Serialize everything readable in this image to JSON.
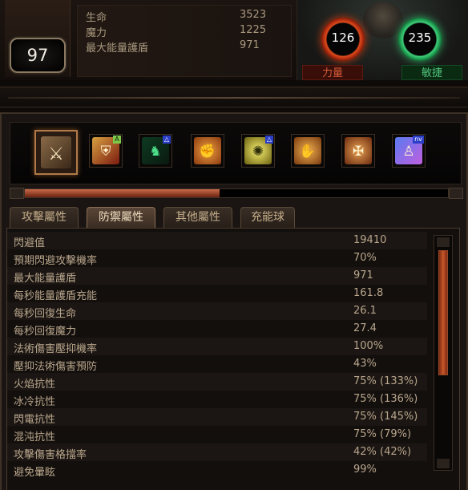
{
  "header": {
    "level": "97",
    "stats": [
      {
        "label": "生命",
        "value": "3523"
      },
      {
        "label": "魔力",
        "value": "1225"
      },
      {
        "label": "最大能量護盾",
        "value": "971"
      }
    ],
    "strength": {
      "value": "126",
      "label": "力量"
    },
    "dexterity": {
      "value": "235",
      "label": "敏捷"
    }
  },
  "skill_bar": {
    "gems": [
      {
        "icon": "sword-icon",
        "badge": ""
      },
      {
        "icon": "shield-icon",
        "badge": "A"
      },
      {
        "icon": "ghost-warrior-icon",
        "badge": "△"
      },
      {
        "icon": "fist-strike-icon",
        "badge": ""
      },
      {
        "icon": "lightning-burst-icon",
        "badge": "△"
      },
      {
        "icon": "grasp-icon",
        "badge": ""
      },
      {
        "icon": "crossed-blade-icon",
        "badge": ""
      },
      {
        "icon": "spectral-figure-icon",
        "badge": "nv"
      }
    ],
    "progress": 0.46
  },
  "tabs": [
    {
      "label": "攻擊屬性",
      "active": false
    },
    {
      "label": "防禦屬性",
      "active": true
    },
    {
      "label": "其他屬性",
      "active": false
    },
    {
      "label": "充能球",
      "active": false
    }
  ],
  "defense_stats": [
    {
      "name": "閃避值",
      "value": "19410"
    },
    {
      "name": "預期閃避攻擊機率",
      "value": "70%"
    },
    {
      "name": "最大能量護盾",
      "value": "971"
    },
    {
      "name": "每秒能量護盾充能",
      "value": "161.8"
    },
    {
      "name": "每秒回復生命",
      "value": "26.1"
    },
    {
      "name": "每秒回復魔力",
      "value": "27.4"
    },
    {
      "name": "法術傷害壓抑機率",
      "value": "100%"
    },
    {
      "name": "壓抑法術傷害預防",
      "value": "43%"
    },
    {
      "name": "火焰抗性",
      "value": "75% (133%)"
    },
    {
      "name": "冰冷抗性",
      "value": "75% (136%)"
    },
    {
      "name": "閃電抗性",
      "value": "75% (145%)"
    },
    {
      "name": "混沌抗性",
      "value": "75% (79%)"
    },
    {
      "name": "攻擊傷害格擋率",
      "value": "42% (42%)"
    },
    {
      "name": "避免暈眩",
      "value": "99%"
    }
  ],
  "colors": {
    "strength": "#e04a1c",
    "dexterity": "#3ed07a",
    "accent": "#c8562a"
  }
}
